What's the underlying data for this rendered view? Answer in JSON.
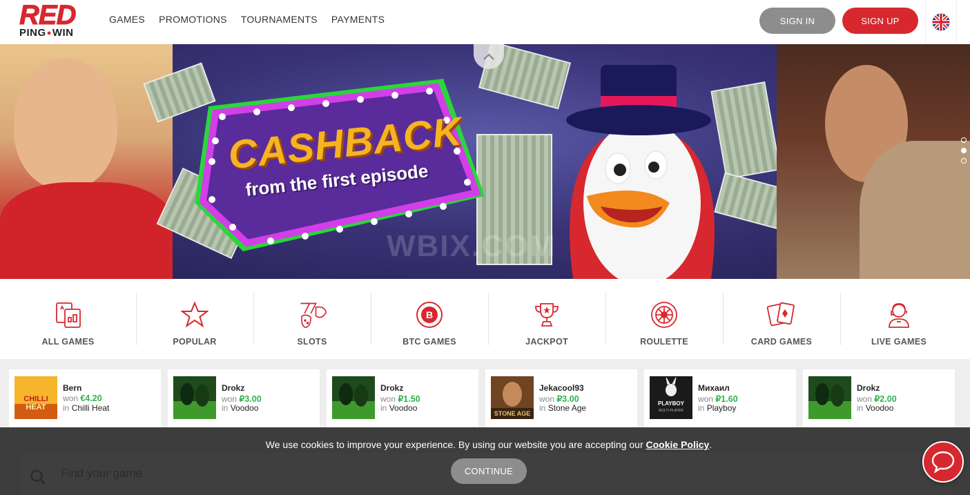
{
  "header": {
    "logo_top": "RED",
    "logo_bottom_left": "PING",
    "logo_bottom_right": "WIN",
    "nav": [
      "GAMES",
      "PROMOTIONS",
      "TOURNAMENTS",
      "PAYMENTS"
    ],
    "signin_label": "SIGN IN",
    "signup_label": "SIGN UP",
    "language_icon": "uk-flag-icon"
  },
  "banner": {
    "headline": "CASHBACK",
    "subline": "from the first episode",
    "slides_count": 3,
    "active_slide": 2
  },
  "categories": [
    {
      "label": "ALL GAMES",
      "icon": "all-games-icon"
    },
    {
      "label": "POPULAR",
      "icon": "star-icon"
    },
    {
      "label": "SLOTS",
      "icon": "slots-fruit-icon"
    },
    {
      "label": "BTC GAMES",
      "icon": "bitcoin-icon"
    },
    {
      "label": "JACKPOT",
      "icon": "trophy-icon"
    },
    {
      "label": "ROULETTE",
      "icon": "roulette-icon"
    },
    {
      "label": "CARD GAMES",
      "icon": "cards-icon"
    },
    {
      "label": "LIVE GAMES",
      "icon": "live-dealer-icon"
    }
  ],
  "winners": [
    {
      "name": "Bern",
      "won_prefix": "won",
      "amount": "€4.20",
      "in_prefix": "in",
      "game": "Chilli Heat",
      "thumb_color": "#f4a21c"
    },
    {
      "name": "Drokz",
      "won_prefix": "won",
      "amount": "₽3.00",
      "in_prefix": "in",
      "game": "Voodoo",
      "thumb_color": "#2e6a2a"
    },
    {
      "name": "Drokz",
      "won_prefix": "won",
      "amount": "₽1.50",
      "in_prefix": "in",
      "game": "Voodoo",
      "thumb_color": "#2e6a2a"
    },
    {
      "name": "Jekacool93",
      "won_prefix": "won",
      "amount": "₽3.00",
      "in_prefix": "in",
      "game": "Stone Age",
      "thumb_color": "#8a5a2e"
    },
    {
      "name": "Михаил",
      "won_prefix": "won",
      "amount": "₽1.60",
      "in_prefix": "in",
      "game": "Playboy",
      "thumb_color": "#1c1c1c"
    },
    {
      "name": "Drokz",
      "won_prefix": "won",
      "amount": "₽2.00",
      "in_prefix": "in",
      "game": "Voodoo",
      "thumb_color": "#2e6a2a"
    }
  ],
  "search": {
    "placeholder": "Find your game"
  },
  "cookie": {
    "text_before": "We use cookies to improve your experience. By using our website you are accepting our ",
    "link": "Cookie Policy",
    "text_after": ".",
    "continue_label": "CONTINUE"
  },
  "colors": {
    "brand_red": "#d7282f",
    "button_grey": "#8d8d8d",
    "win_green": "#2fb34d"
  }
}
